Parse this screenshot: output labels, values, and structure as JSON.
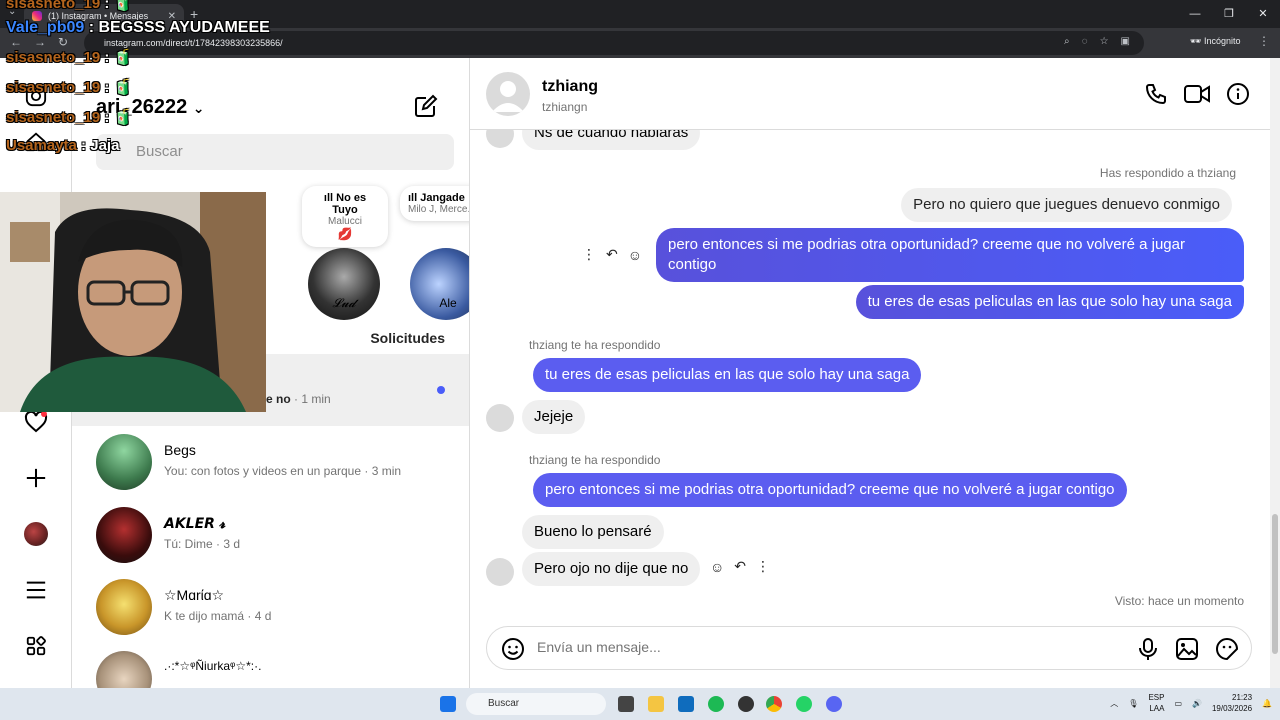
{
  "browser": {
    "tab_title": "(1) Instagram • Mensajes",
    "url": "instagram.com/direct/t/17842398303235866/",
    "incognito_label": "Incógnito"
  },
  "stream_overlay": [
    {
      "user": "sisasneto_19",
      "message": "",
      "emoji": "🧃"
    },
    {
      "user": "Vale_pb09",
      "message": "BEGSSS AYUDAMEEE",
      "emoji": ""
    },
    {
      "user": "sisasneto_19",
      "message": "",
      "emoji": "🧃"
    },
    {
      "user": "sisasneto_19",
      "message": "",
      "emoji": "🧃"
    },
    {
      "user": "sisasneto_19",
      "message": "",
      "emoji": "🧃"
    },
    {
      "user": "Usamayta",
      "message": "Jaja",
      "emoji": ""
    }
  ],
  "inbox": {
    "username": "ari_26222",
    "search_placeholder": "Buscar",
    "requests_label": "Solicitudes",
    "notes": [
      {
        "title": "No es Tuyo",
        "subtitle": "Malucci",
        "name": "𝓛𝓾𝓭"
      },
      {
        "title": "Jangade",
        "subtitle": "Milo J, Merce...",
        "name": "Ale"
      }
    ],
    "conversations": [
      {
        "name": "",
        "preview": "e no",
        "time": "· 1 min",
        "unread": true
      },
      {
        "name": "Begs",
        "preview": "You: con fotos y videos en un parque",
        "time": "· 3 min"
      },
      {
        "name": "𝘼𝙆𝙇𝙀𝙍 𝓻",
        "preview": "Tú: Dime",
        "time": "· 3 d"
      },
      {
        "name": "☆Mɑrίɑ☆",
        "preview": "K te dijo mamá",
        "time": "· 4 d"
      },
      {
        "name": ".·:*☆ᵠÑiurkaᵠ☆*:·.",
        "preview": "",
        "time": ""
      }
    ]
  },
  "chat": {
    "contact_name": "tzhiang",
    "contact_handle": "tzhiangn",
    "partial_top_message": "Ns de cuando hablaras",
    "context_1": "Has respondido a thziang",
    "reply_quote_1": "Pero no quiero que juegues denuevo conmigo",
    "out_message_1": "pero entonces si me podrias otra oportunidad? creeme que no volveré a jugar contigo",
    "out_message_2": "tu eres de esas peliculas en las que solo hay una saga",
    "context_2": "thziang te ha respondido",
    "quoted_in_1": "tu eres de esas peliculas en las que solo hay una saga",
    "in_message_1": "Jejeje",
    "context_3": "thziang te ha respondido",
    "quoted_in_2": "pero entonces si me podrias otra oportunidad? creeme que no volveré a jugar contigo",
    "in_message_2": "Bueno lo pensaré",
    "in_message_3": "Pero ojo no dije que no",
    "seen_label": "Visto: hace un momento",
    "composer_placeholder": "Envía un mensaje..."
  },
  "taskbar": {
    "search_label": "Buscar",
    "lang_top": "ESP",
    "lang_bottom": "LAA",
    "time": "21:23",
    "date": "19/03/2026"
  },
  "colors": {
    "outgoing_bubble": "#4a5df9",
    "incoming_bubble": "#efefef",
    "unread_dot": "#4a5df9"
  }
}
